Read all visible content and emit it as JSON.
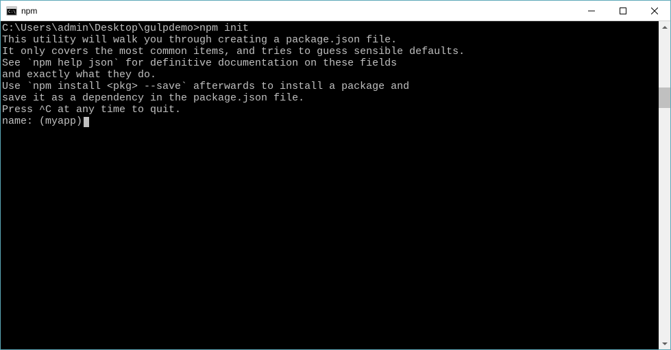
{
  "titlebar": {
    "title": "npm"
  },
  "terminal": {
    "prompt": "C:\\Users\\admin\\Desktop\\gulpdemo>",
    "command": "npm init",
    "lines": [
      "This utility will walk you through creating a package.json file.",
      "It only covers the most common items, and tries to guess sensible defaults.",
      "",
      "See `npm help json` for definitive documentation on these fields",
      "and exactly what they do.",
      "",
      "Use `npm install <pkg> --save` afterwards to install a package and",
      "save it as a dependency in the package.json file.",
      "",
      "Press ^C at any time to quit."
    ],
    "input_prompt": "name: (myapp)",
    "input_value": ""
  }
}
